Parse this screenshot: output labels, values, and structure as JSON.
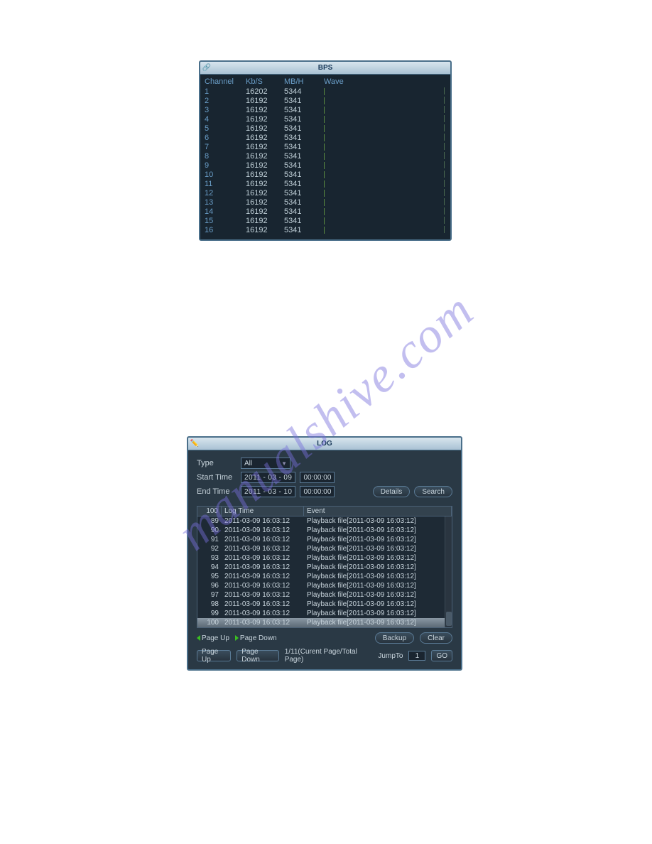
{
  "watermark": "manualshive.com",
  "bps": {
    "title": "BPS",
    "headers": {
      "channel": "Channel",
      "kbs": "Kb/S",
      "mbh": "MB/H",
      "wave": "Wave"
    },
    "rows": [
      {
        "ch": "1",
        "kbs": "16202",
        "mbh": "5344"
      },
      {
        "ch": "2",
        "kbs": "16192",
        "mbh": "5341"
      },
      {
        "ch": "3",
        "kbs": "16192",
        "mbh": "5341"
      },
      {
        "ch": "4",
        "kbs": "16192",
        "mbh": "5341"
      },
      {
        "ch": "5",
        "kbs": "16192",
        "mbh": "5341"
      },
      {
        "ch": "6",
        "kbs": "16192",
        "mbh": "5341"
      },
      {
        "ch": "7",
        "kbs": "16192",
        "mbh": "5341"
      },
      {
        "ch": "8",
        "kbs": "16192",
        "mbh": "5341"
      },
      {
        "ch": "9",
        "kbs": "16192",
        "mbh": "5341"
      },
      {
        "ch": "10",
        "kbs": "16192",
        "mbh": "5341"
      },
      {
        "ch": "11",
        "kbs": "16192",
        "mbh": "5341"
      },
      {
        "ch": "12",
        "kbs": "16192",
        "mbh": "5341"
      },
      {
        "ch": "13",
        "kbs": "16192",
        "mbh": "5341"
      },
      {
        "ch": "14",
        "kbs": "16192",
        "mbh": "5341"
      },
      {
        "ch": "15",
        "kbs": "16192",
        "mbh": "5341"
      },
      {
        "ch": "16",
        "kbs": "16192",
        "mbh": "5341"
      }
    ]
  },
  "log": {
    "title": "LOG",
    "labels": {
      "type": "Type",
      "start": "Start Time",
      "end": "End Time",
      "details": "Details",
      "search": "Search",
      "backup": "Backup",
      "clear": "Clear",
      "pageup_link": "Page Up",
      "pagedown_link": "Page Down",
      "pageup_btn": "Page Up",
      "pagedown_btn": "Page Down",
      "page_info": "1/11(Curent Page/Total Page)",
      "jumpto": "JumpTo",
      "go": "GO"
    },
    "type_value": "All",
    "start_date": {
      "y": "2011",
      "m": "03",
      "d": "09"
    },
    "start_time": {
      "h": "00",
      "mi": "00",
      "s": "00"
    },
    "end_date": {
      "y": "2011",
      "m": "03",
      "d": "10"
    },
    "end_time": {
      "h": "00",
      "mi": "00",
      "s": "00"
    },
    "jump_value": "1",
    "table": {
      "total": "100",
      "h_time": "Log Time",
      "h_event": "Event",
      "rows": [
        {
          "n": "89",
          "t": "2011-03-09 16:03:12",
          "e": "Playback file[2011-03-09 16:03:12]"
        },
        {
          "n": "90",
          "t": "2011-03-09 16:03:12",
          "e": "Playback file[2011-03-09 16:03:12]"
        },
        {
          "n": "91",
          "t": "2011-03-09 16:03:12",
          "e": "Playback file[2011-03-09 16:03:12]"
        },
        {
          "n": "92",
          "t": "2011-03-09 16:03:12",
          "e": "Playback file[2011-03-09 16:03:12]"
        },
        {
          "n": "93",
          "t": "2011-03-09 16:03:12",
          "e": "Playback file[2011-03-09 16:03:12]"
        },
        {
          "n": "94",
          "t": "2011-03-09 16:03:12",
          "e": "Playback file[2011-03-09 16:03:12]"
        },
        {
          "n": "95",
          "t": "2011-03-09 16:03:12",
          "e": "Playback file[2011-03-09 16:03:12]"
        },
        {
          "n": "96",
          "t": "2011-03-09 16:03:12",
          "e": "Playback file[2011-03-09 16:03:12]"
        },
        {
          "n": "97",
          "t": "2011-03-09 16:03:12",
          "e": "Playback file[2011-03-09 16:03:12]"
        },
        {
          "n": "98",
          "t": "2011-03-09 16:03:12",
          "e": "Playback file[2011-03-09 16:03:12]"
        },
        {
          "n": "99",
          "t": "2011-03-09 16:03:12",
          "e": "Playback file[2011-03-09 16:03:12]"
        },
        {
          "n": "100",
          "t": "2011-03-09 16:03:12",
          "e": "Playback file[2011-03-09 16:03:12]"
        }
      ],
      "selected_index": 11
    }
  },
  "chart_data": {
    "type": "table",
    "title": "BPS",
    "columns": [
      "Channel",
      "Kb/S",
      "MB/H"
    ],
    "rows": [
      [
        1,
        16202,
        5344
      ],
      [
        2,
        16192,
        5341
      ],
      [
        3,
        16192,
        5341
      ],
      [
        4,
        16192,
        5341
      ],
      [
        5,
        16192,
        5341
      ],
      [
        6,
        16192,
        5341
      ],
      [
        7,
        16192,
        5341
      ],
      [
        8,
        16192,
        5341
      ],
      [
        9,
        16192,
        5341
      ],
      [
        10,
        16192,
        5341
      ],
      [
        11,
        16192,
        5341
      ],
      [
        12,
        16192,
        5341
      ],
      [
        13,
        16192,
        5341
      ],
      [
        14,
        16192,
        5341
      ],
      [
        15,
        16192,
        5341
      ],
      [
        16,
        16192,
        5341
      ]
    ]
  }
}
